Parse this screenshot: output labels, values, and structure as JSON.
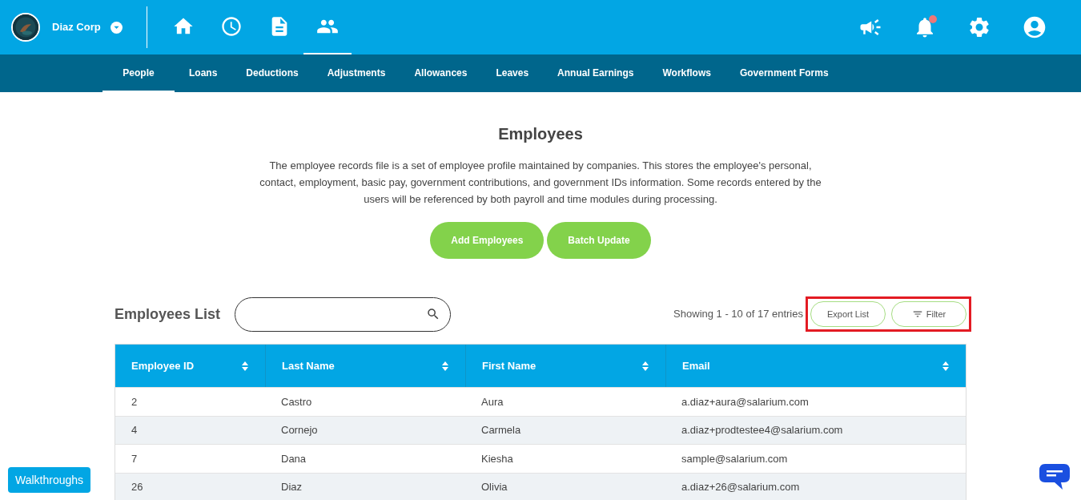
{
  "company": {
    "name": "Diaz Corp"
  },
  "nav_icons": [
    {
      "kind": "home",
      "selected": false
    },
    {
      "kind": "clock",
      "selected": false
    },
    {
      "kind": "document",
      "selected": false
    },
    {
      "kind": "people",
      "selected": true
    }
  ],
  "notifications": {
    "unread": true
  },
  "tabs": [
    {
      "label": "People",
      "selected": true
    },
    {
      "label": "Loans",
      "selected": false
    },
    {
      "label": "Deductions",
      "selected": false
    },
    {
      "label": "Adjustments",
      "selected": false
    },
    {
      "label": "Allowances",
      "selected": false
    },
    {
      "label": "Leaves",
      "selected": false
    },
    {
      "label": "Annual Earnings",
      "selected": false
    },
    {
      "label": "Workflows",
      "selected": false
    },
    {
      "label": "Government Forms",
      "selected": false
    }
  ],
  "heading": "Employees",
  "description": "The employee records file is a set of employee profile maintained by companies. This stores the employee's personal, contact, employment, basic pay, government contributions, and government IDs information. Some records entered by the users will be referenced by both payroll and time modules during processing.",
  "actions": [
    "Add Employees",
    "Batch Update"
  ],
  "list_title": "Employees List",
  "entries": "Showing 1 - 10 of 17 entries",
  "list_buttons": [
    {
      "label": "Export List",
      "kind": "plain"
    },
    {
      "label": "Filter",
      "kind": "filter"
    }
  ],
  "table": {
    "columns": [
      "Employee ID",
      "Last Name",
      "First Name",
      "Email"
    ],
    "rows": [
      [
        "2",
        "Castro",
        "Aura",
        "a.diaz+aura@salarium.com"
      ],
      [
        "4",
        "Cornejo",
        "Carmela",
        "a.diaz+prodtestee4@salarium.com"
      ],
      [
        "7",
        "Dana",
        "Kiesha",
        "sample@salarium.com"
      ],
      [
        "26",
        "Diaz",
        "Olivia",
        "a.diaz+26@salarium.com"
      ]
    ]
  },
  "walkthroughs": "Walkthroughs"
}
